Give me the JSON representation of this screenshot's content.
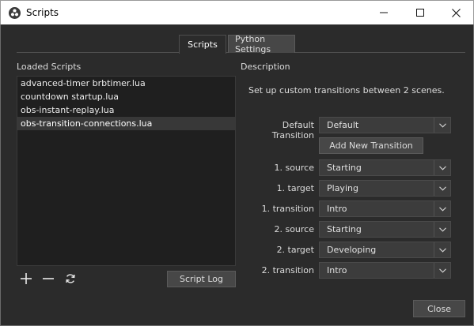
{
  "window": {
    "title": "Scripts",
    "app_icon": "obs-logo-icon",
    "controls": [
      "minimize-icon",
      "maximize-icon",
      "close-icon"
    ]
  },
  "tabs": [
    {
      "label": "Scripts",
      "active": true
    },
    {
      "label": "Python Settings",
      "active": false
    }
  ],
  "loaded_scripts": {
    "label": "Loaded Scripts",
    "items": [
      {
        "name": "advanced-timer brbtimer.lua",
        "selected": false
      },
      {
        "name": "countdown startup.lua",
        "selected": false
      },
      {
        "name": "obs-instant-replay.lua",
        "selected": false
      },
      {
        "name": "obs-transition-connections.lua",
        "selected": true
      }
    ],
    "actions": [
      "plus-icon",
      "minus-icon",
      "refresh-icon"
    ],
    "script_log_label": "Script Log"
  },
  "description": {
    "label": "Description",
    "text": "Set up custom transitions between 2 scenes."
  },
  "settings": {
    "default_transition": {
      "label": "Default Transition",
      "value": "Default"
    },
    "add_button_label": "Add New Transition",
    "rows": [
      {
        "label": "1. source",
        "value": "Starting"
      },
      {
        "label": "1. target",
        "value": "Playing"
      },
      {
        "label": "1. transition",
        "value": "Intro"
      },
      {
        "label": "2. source",
        "value": "Starting"
      },
      {
        "label": "2. target",
        "value": "Developing"
      },
      {
        "label": "2. transition",
        "value": "Intro"
      }
    ]
  },
  "footer": {
    "close_label": "Close"
  },
  "colors": {
    "background": "#2b2b2b",
    "list_bg": "#1f1f1f",
    "combo_bg": "#3c3c3c",
    "button_bg": "#474747",
    "selection": "#383838"
  }
}
